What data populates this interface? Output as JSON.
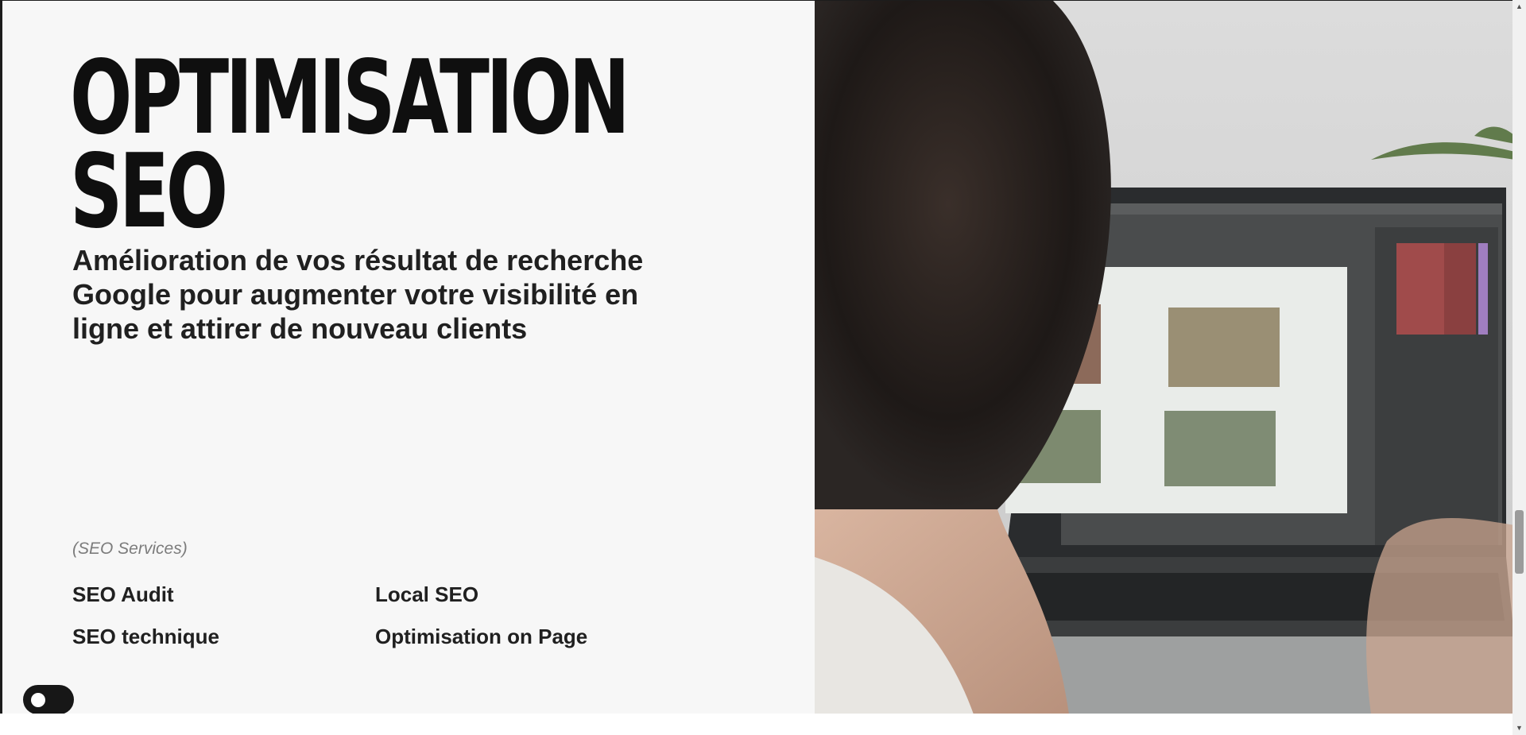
{
  "hero": {
    "title_line1": "OPTIMISATION",
    "title_line2": "SEO",
    "subtitle": "Amélioration de vos résultat de recherche Google pour augmenter votre visibilité en ligne et attirer de nouveau clients"
  },
  "services": {
    "label": "(SEO Services)",
    "items": [
      {
        "label": "SEO Audit"
      },
      {
        "label": "Local SEO"
      },
      {
        "label": "SEO technique"
      },
      {
        "label": "Optimisation on Page"
      }
    ]
  },
  "theme_toggle": {
    "state": "off"
  },
  "scrollbar": {
    "up_icon": "▲",
    "down_icon": "▼",
    "position": 0.74
  },
  "colors": {
    "background": "#f7f7f7",
    "text": "#0f0f0f",
    "muted": "#7c7c7c",
    "toggle": "#171717"
  }
}
